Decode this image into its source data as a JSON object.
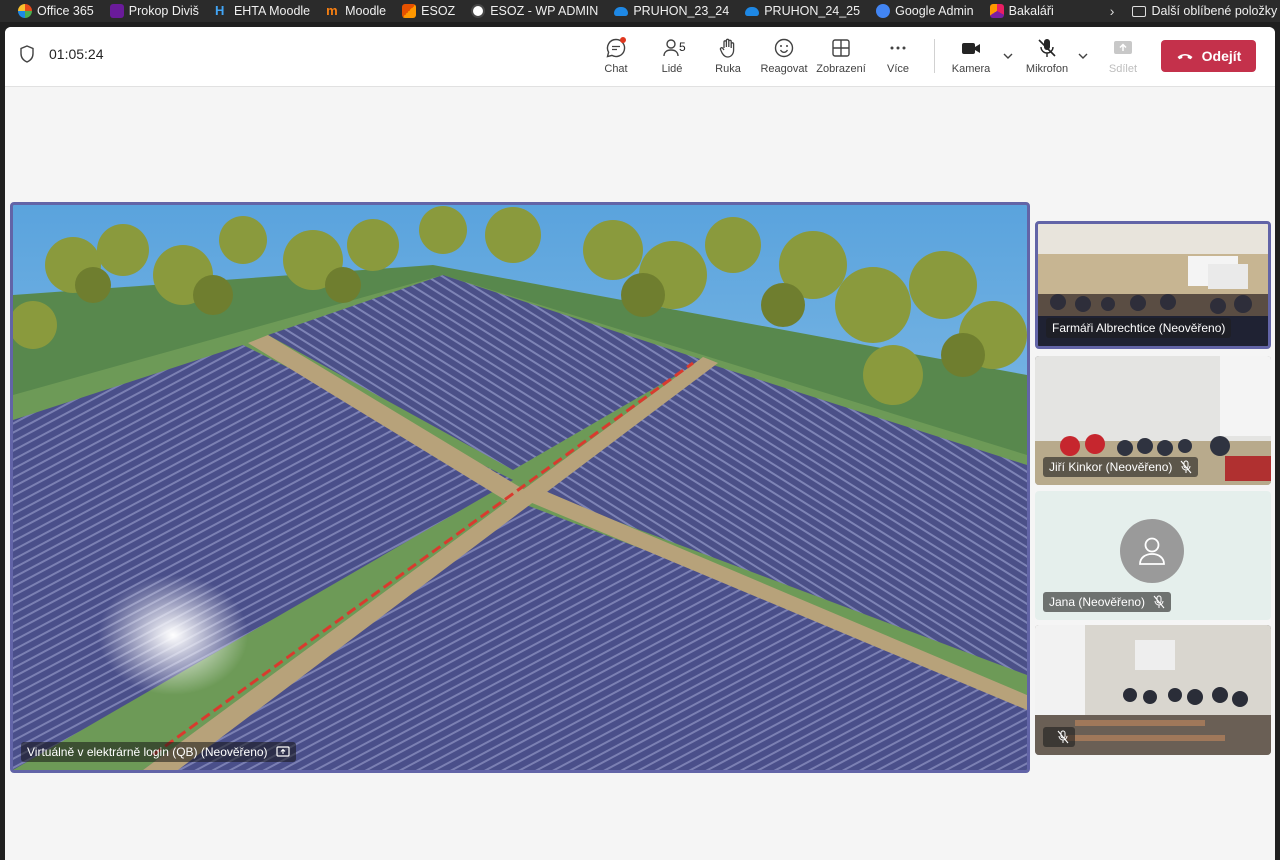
{
  "bookmarks": {
    "items": [
      {
        "label": "Office 365",
        "icon": "office-icon",
        "color": "#e64a19"
      },
      {
        "label": "Prokop Diviš",
        "icon": "prokop-icon",
        "color": "#6a1b9a"
      },
      {
        "label": "EHTA Moodle",
        "icon": "h2-icon",
        "color": "#1565c0"
      },
      {
        "label": "Moodle",
        "icon": "moodle-icon",
        "color": "#f98012"
      },
      {
        "label": "ESOZ",
        "icon": "esoz-icon",
        "color": "#e65100"
      },
      {
        "label": "ESOZ - WP ADMIN",
        "icon": "wordpress-icon",
        "color": "#ffffff"
      },
      {
        "label": "PRUHON_23_24",
        "icon": "cloud-icon",
        "color": "#1e88e5"
      },
      {
        "label": "PRUHON_24_25",
        "icon": "cloud-icon",
        "color": "#1e88e5"
      },
      {
        "label": "Google Admin",
        "icon": "google-admin-icon",
        "color": "#4285f4"
      },
      {
        "label": "Bakaláři",
        "icon": "bakalari-icon",
        "color": "#7b1fa2"
      }
    ],
    "other_label": "Další oblíbené položky"
  },
  "toolbar": {
    "timer": "01:05:24",
    "chat_label": "Chat",
    "people_label": "Lidé",
    "people_count": "5",
    "hand_label": "Ruka",
    "react_label": "Reagovat",
    "view_label": "Zobrazení",
    "more_label": "Více",
    "camera_label": "Kamera",
    "mic_label": "Mikrofon",
    "share_label": "Sdílet",
    "leave_label": "Odejít",
    "accent": "#6264a7",
    "leave_color": "#c4314b"
  },
  "stage": {
    "main_participant": "Virtuálně v elektrárně login (QB) (Neověřeno)"
  },
  "participants": [
    {
      "name": "Farmáři Albrechtice (Neověřeno)",
      "muted": false,
      "active": true
    },
    {
      "name": "Jiří Kinkor (Neověřeno)",
      "muted": true,
      "active": false
    },
    {
      "name": "Jana (Neověřeno)",
      "muted": true,
      "active": false,
      "avatar": true
    },
    {
      "name": "",
      "muted": true,
      "active": false
    }
  ]
}
